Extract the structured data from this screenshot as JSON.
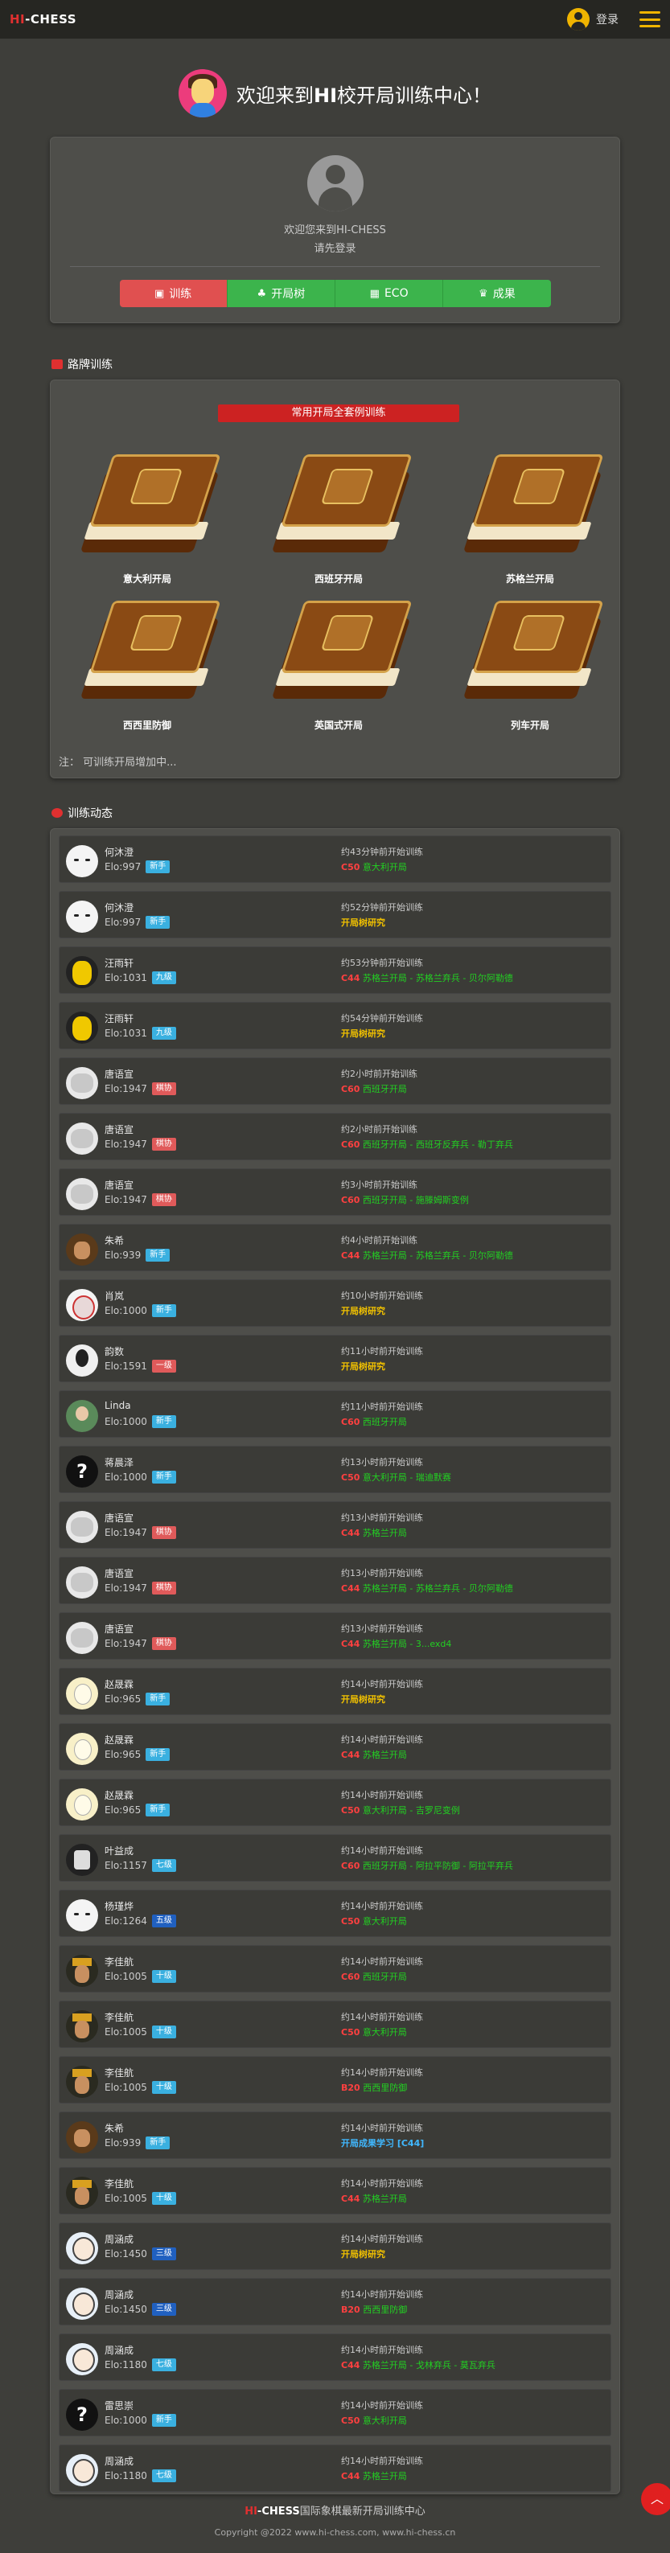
{
  "header": {
    "logo_hi": "HI",
    "logo_rest": "-CHESS",
    "login_label": "登录",
    "user_icon": "user-circle-icon",
    "menu_icon": "hamburger-menu-icon",
    "accent_color": "#f0b400"
  },
  "welcome": {
    "title_prefix": "欢迎来到",
    "title_hi": "HI",
    "title_suffix": "校开局训练中心！"
  },
  "profile": {
    "welcome_line": "欢迎您来到HI-CHESS",
    "login_prompt": "请先登录",
    "tabs": [
      {
        "label": "训练",
        "icon": "book-icon",
        "color": "#e05050"
      },
      {
        "label": "开局树",
        "icon": "tree-icon",
        "color": "#3cb44c"
      },
      {
        "label": "ECO",
        "icon": "table-icon",
        "color": "#3cb44c"
      },
      {
        "label": "成果",
        "icon": "crown-icon",
        "color": "#3cb44c"
      }
    ]
  },
  "routes": {
    "section_title": "路牌训练",
    "banner": "常用开局全套例训练",
    "items": [
      {
        "label": "意大利开局"
      },
      {
        "label": "西班牙开局"
      },
      {
        "label": "苏格兰开局"
      },
      {
        "label": "西西里防御"
      },
      {
        "label": "英国式开局"
      },
      {
        "label": "列车开局"
      }
    ],
    "note": "注： 可训练开局增加中..."
  },
  "feed": {
    "section_title": "训练动态",
    "rows": [
      {
        "name": "何沐澄",
        "elo": "Elo:997",
        "badge": "新手",
        "badge_color": "#3ab0e0",
        "avatar": "white",
        "time": "约43分钟前开始训练",
        "code": "C50",
        "text": "意大利开局",
        "style": ""
      },
      {
        "name": "何沐澄",
        "elo": "Elo:997",
        "badge": "新手",
        "badge_color": "#3ab0e0",
        "avatar": "white",
        "time": "约52分钟前开始训练",
        "code": "",
        "text": "开局树研究",
        "style": "yellow"
      },
      {
        "name": "汪雨轩",
        "elo": "Elo:1031",
        "badge": "九级",
        "badge_color": "#3ab0e0",
        "avatar": "yellow",
        "time": "约53分钟前开始训练",
        "code": "C44",
        "text": "苏格兰开局 - 苏格兰弃兵 - 贝尔阿勒德",
        "style": ""
      },
      {
        "name": "汪雨轩",
        "elo": "Elo:1031",
        "badge": "九级",
        "badge_color": "#3ab0e0",
        "avatar": "yellow",
        "time": "约54分钟前开始训练",
        "code": "",
        "text": "开局树研究",
        "style": "yellow"
      },
      {
        "name": "唐语宣",
        "elo": "Elo:1947",
        "badge": "棋协",
        "badge_color": "#e05a5a",
        "avatar": "gray",
        "time": "约2小时前开始训练",
        "code": "C60",
        "text": "西班牙开局",
        "style": ""
      },
      {
        "name": "唐语宣",
        "elo": "Elo:1947",
        "badge": "棋协",
        "badge_color": "#e05a5a",
        "avatar": "gray",
        "time": "约2小时前开始训练",
        "code": "C60",
        "text": "西班牙开局 - 西班牙反弃兵 - 勒丁弃兵",
        "style": ""
      },
      {
        "name": "唐语宣",
        "elo": "Elo:1947",
        "badge": "棋协",
        "badge_color": "#e05a5a",
        "avatar": "gray",
        "time": "约3小时前开始训练",
        "code": "C60",
        "text": "西班牙开局 - 施滕姆斯变例",
        "style": ""
      },
      {
        "name": "朱希",
        "elo": "Elo:939",
        "badge": "新手",
        "badge_color": "#3ab0e0",
        "avatar": "brown",
        "time": "约4小时前开始训练",
        "code": "C44",
        "text": "苏格兰开局 - 苏格兰弃兵 - 贝尔阿勒德",
        "style": ""
      },
      {
        "name": "肖岚",
        "elo": "Elo:1000",
        "badge": "新手",
        "badge_color": "#3ab0e0",
        "avatar": "mask",
        "time": "约10小时前开始训练",
        "code": "",
        "text": "开局树研究",
        "style": "yellow"
      },
      {
        "name": "韵数",
        "elo": "Elo:1591",
        "badge": "一级",
        "badge_color": "#e05a5a",
        "avatar": "bird",
        "time": "约11小时前开始训练",
        "code": "",
        "text": "开局树研究",
        "style": "yellow"
      },
      {
        "name": "Linda",
        "elo": "Elo:1000",
        "badge": "新手",
        "badge_color": "#3ab0e0",
        "avatar": "green",
        "time": "约11小时前开始训练",
        "code": "C60",
        "text": "西班牙开局",
        "style": ""
      },
      {
        "name": "蒋晨泽",
        "elo": "Elo:1000",
        "badge": "新手",
        "badge_color": "#3ab0e0",
        "avatar": "question",
        "time": "约13小时前开始训练",
        "code": "C50",
        "text": "意大利开局 - 瑞迪默赛",
        "style": ""
      },
      {
        "name": "唐语宣",
        "elo": "Elo:1947",
        "badge": "棋协",
        "badge_color": "#e05a5a",
        "avatar": "gray",
        "time": "约13小时前开始训练",
        "code": "C44",
        "text": "苏格兰开局",
        "style": ""
      },
      {
        "name": "唐语宣",
        "elo": "Elo:1947",
        "badge": "棋协",
        "badge_color": "#e05a5a",
        "avatar": "gray",
        "time": "约13小时前开始训练",
        "code": "C44",
        "text": "苏格兰开局 - 苏格兰弃兵 - 贝尔阿勒德",
        "style": ""
      },
      {
        "name": "唐语宣",
        "elo": "Elo:1947",
        "badge": "棋协",
        "badge_color": "#e05a5a",
        "avatar": "gray",
        "time": "约13小时前开始训练",
        "code": "C44",
        "text": "苏格兰开局 - 3...exd4",
        "style": ""
      },
      {
        "name": "赵晟霖",
        "elo": "Elo:965",
        "badge": "新手",
        "badge_color": "#3ab0e0",
        "avatar": "egg",
        "time": "约14小时前开始训练",
        "code": "",
        "text": "开局树研究",
        "style": "yellow"
      },
      {
        "name": "赵晟霖",
        "elo": "Elo:965",
        "badge": "新手",
        "badge_color": "#3ab0e0",
        "avatar": "egg",
        "time": "约14小时前开始训练",
        "code": "C44",
        "text": "苏格兰开局",
        "style": ""
      },
      {
        "name": "赵晟霖",
        "elo": "Elo:965",
        "badge": "新手",
        "badge_color": "#3ab0e0",
        "avatar": "egg",
        "time": "约14小时前开始训练",
        "code": "C50",
        "text": "意大利开局 - 吉罗尼变例",
        "style": ""
      },
      {
        "name": "叶益成",
        "elo": "Elo:1157",
        "badge": "七级",
        "badge_color": "#3ab0e0",
        "avatar": "robot",
        "time": "约14小时前开始训练",
        "code": "C60",
        "text": "西班牙开局 - 阿拉平防御 - 阿拉平弃兵",
        "style": ""
      },
      {
        "name": "杨瑾烨",
        "elo": "Elo:1264",
        "badge": "五级",
        "badge_color": "#2060c0",
        "avatar": "white",
        "time": "约14小时前开始训练",
        "code": "C50",
        "text": "意大利开局",
        "style": ""
      },
      {
        "name": "李佳航",
        "elo": "Elo:1005",
        "badge": "十级",
        "badge_color": "#3ab0e0",
        "avatar": "general",
        "time": "约14小时前开始训练",
        "code": "C60",
        "text": "西班牙开局",
        "style": ""
      },
      {
        "name": "李佳航",
        "elo": "Elo:1005",
        "badge": "十级",
        "badge_color": "#3ab0e0",
        "avatar": "general",
        "time": "约14小时前开始训练",
        "code": "C50",
        "text": "意大利开局",
        "style": ""
      },
      {
        "name": "李佳航",
        "elo": "Elo:1005",
        "badge": "十级",
        "badge_color": "#3ab0e0",
        "avatar": "general",
        "time": "约14小时前开始训练",
        "code": "B20",
        "text": "西西里防御",
        "style": ""
      },
      {
        "name": "朱希",
        "elo": "Elo:939",
        "badge": "新手",
        "badge_color": "#3ab0e0",
        "avatar": "brown",
        "time": "约14小时前开始训练",
        "code": "",
        "text": "开局成果学习 [C44]",
        "style": "blue"
      },
      {
        "name": "李佳航",
        "elo": "Elo:1005",
        "badge": "十级",
        "badge_color": "#3ab0e0",
        "avatar": "general",
        "time": "约14小时前开始训练",
        "code": "C44",
        "text": "苏格兰开局",
        "style": ""
      },
      {
        "name": "周涵成",
        "elo": "Elo:1450",
        "badge": "三级",
        "badge_color": "#2060c0",
        "avatar": "boy",
        "time": "约14小时前开始训练",
        "code": "",
        "text": "开局树研究",
        "style": "yellow"
      },
      {
        "name": "周涵成",
        "elo": "Elo:1450",
        "badge": "三级",
        "badge_color": "#2060c0",
        "avatar": "boy",
        "time": "约14小时前开始训练",
        "code": "B20",
        "text": "西西里防御",
        "style": ""
      },
      {
        "name": "周涵成",
        "elo": "Elo:1180",
        "badge": "七级",
        "badge_color": "#3ab0e0",
        "avatar": "boy",
        "time": "约14小时前开始训练",
        "code": "C44",
        "text": "苏格兰开局 - 戈林弃兵 - 莫瓦弃兵",
        "style": ""
      },
      {
        "name": "雷思崇",
        "elo": "Elo:1000",
        "badge": "新手",
        "badge_color": "#3ab0e0",
        "avatar": "question",
        "time": "约14小时前开始训练",
        "code": "C50",
        "text": "意大利开局",
        "style": ""
      },
      {
        "name": "周涵成",
        "elo": "Elo:1180",
        "badge": "七级",
        "badge_color": "#3ab0e0",
        "avatar": "boy",
        "time": "约14小时前开始训练",
        "code": "C44",
        "text": "苏格兰开局",
        "style": ""
      }
    ]
  },
  "footer": {
    "hi": "HI",
    "chess": "-CHESS",
    "line1_rest": "国际象棋最新开局训练中心",
    "line2": "Copyright @2022 www.hi-chess.com, www.hi-chess.cn",
    "top_button_icon": "chevron-up-icon"
  }
}
